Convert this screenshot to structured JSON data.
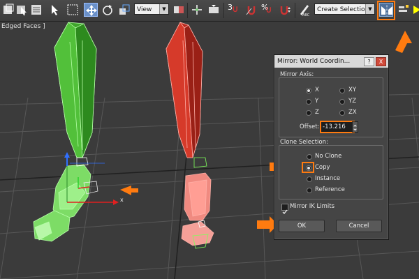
{
  "toolbar": {
    "view_label": "View",
    "snap_3": "3",
    "percent_snap": "%",
    "named_selection_label": "Create Selection Se"
  },
  "viewport": {
    "label": "Edged Faces ]",
    "axis_x": "x"
  },
  "dialog": {
    "title": "Mirror: World Coordin...",
    "help_btn": "?",
    "close_btn": "X",
    "mirror_axis_label": "Mirror Axis:",
    "axes": [
      "X",
      "Y",
      "Z",
      "XY",
      "YZ",
      "ZX"
    ],
    "selected_axis": "X",
    "offset_label": "Offset:",
    "offset_value": "-13.216",
    "clone_label": "Clone Selection:",
    "clone_options": [
      "No Clone",
      "Copy",
      "Instance",
      "Reference"
    ],
    "selected_clone": "Copy",
    "mirror_ik_label": "Mirror IK Limits",
    "mirror_ik_checked": true,
    "ok_label": "OK",
    "cancel_label": "Cancel"
  },
  "colors": {
    "highlight": "#ff7b10",
    "left_leg": "#5ad046",
    "right_leg": "#d03a2a",
    "right_foot": "#f08a80"
  }
}
